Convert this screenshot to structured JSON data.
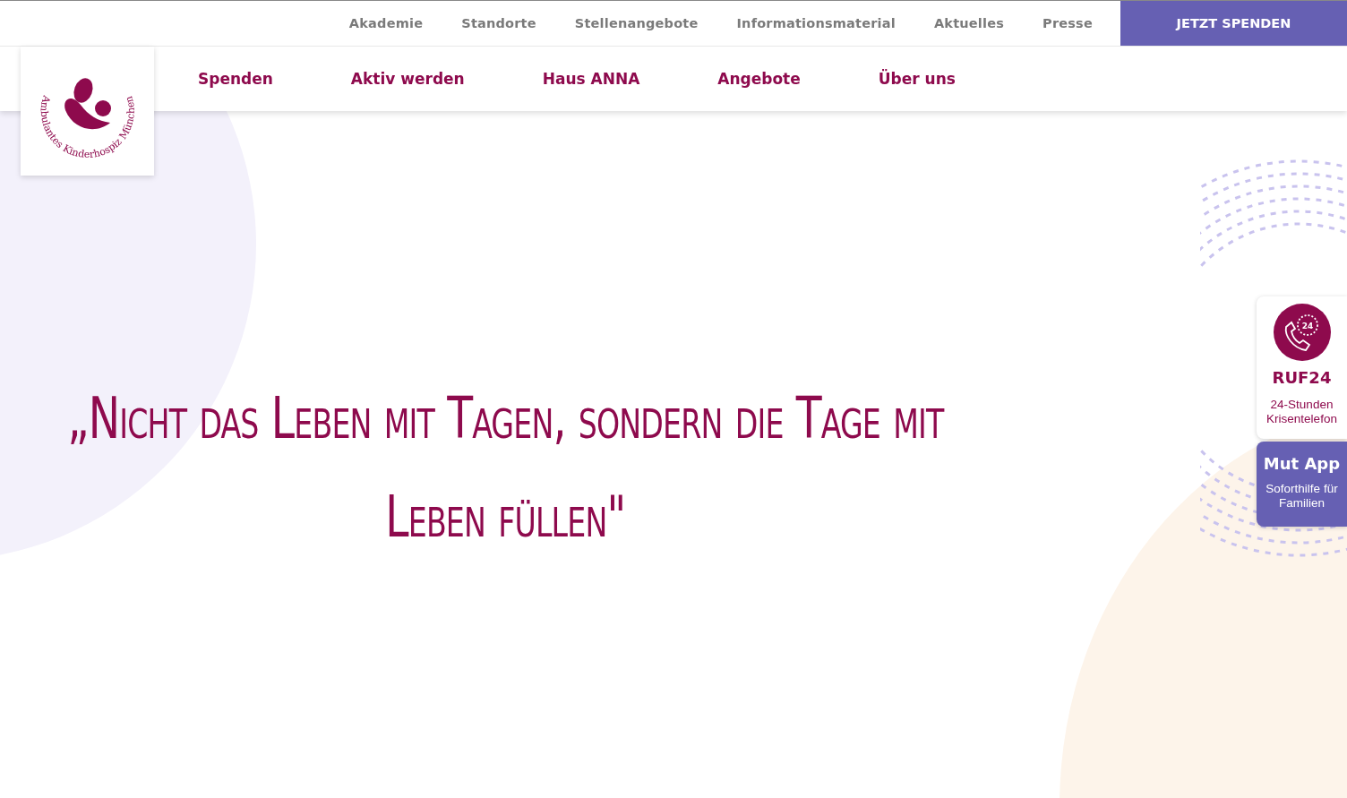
{
  "top_nav": {
    "links": [
      "Akademie",
      "Standorte",
      "Stellenangebote",
      "Informationsmaterial",
      "Aktuelles",
      "Presse"
    ],
    "cta": "JETZT SPENDEN"
  },
  "logo": {
    "text": "Ambulantes Kinderhospiz München"
  },
  "main_nav": {
    "items": [
      "Spenden",
      "Aktiv werden",
      "Haus ANNA",
      "Angebote",
      "Über uns"
    ]
  },
  "quote": "„Nicht das Leben mit Tagen, sondern die Tage mit Leben füllen\"",
  "side_widgets": [
    {
      "kind": "hotline",
      "icon_text": "24",
      "title": "RUF24",
      "subtitle": "24-Stunden Krisentelefon"
    },
    {
      "kind": "app",
      "title": "Mut App",
      "subtitle": "Soforthilfe für Familien"
    }
  ]
}
